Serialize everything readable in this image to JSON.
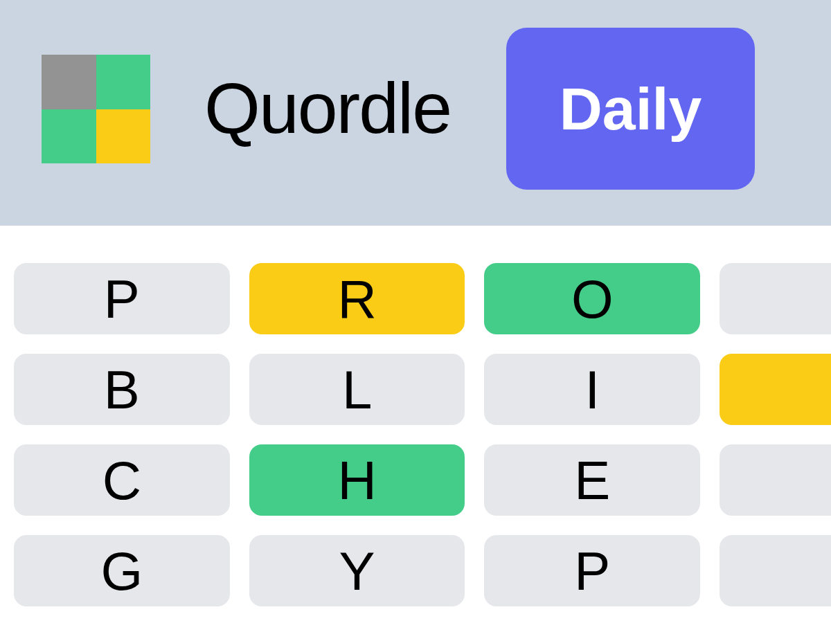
{
  "header": {
    "title": "Quordle",
    "mode_button": {
      "label": "Daily"
    }
  },
  "keyboard": {
    "rows": [
      {
        "keys": [
          {
            "label": "P",
            "color": "#e5e7eb"
          },
          {
            "label": "R",
            "color": "#facc15"
          },
          {
            "label": "O",
            "color": "#43cd89"
          },
          {
            "color": "#e5e7eb"
          }
        ]
      },
      {
        "keys": [
          {
            "label": "B",
            "color": "#e5e7eb"
          },
          {
            "label": "L",
            "color": "#e5e7eb"
          },
          {
            "label": "I",
            "color": "#e5e7eb"
          },
          {
            "color": "#facc15"
          }
        ]
      },
      {
        "keys": [
          {
            "label": "C",
            "color": "#e5e7eb"
          },
          {
            "label": "H",
            "color": "#43cd89"
          },
          {
            "label": "E",
            "color": "#e5e7eb"
          },
          {
            "color": "#e5e7eb"
          }
        ]
      },
      {
        "keys": [
          {
            "label": "G",
            "color": "#e5e7eb"
          },
          {
            "label": "Y",
            "color": "#e5e7eb"
          },
          {
            "label": "P",
            "color": "#e5e7eb"
          },
          {
            "color": "#e5e7eb"
          }
        ]
      }
    ]
  }
}
